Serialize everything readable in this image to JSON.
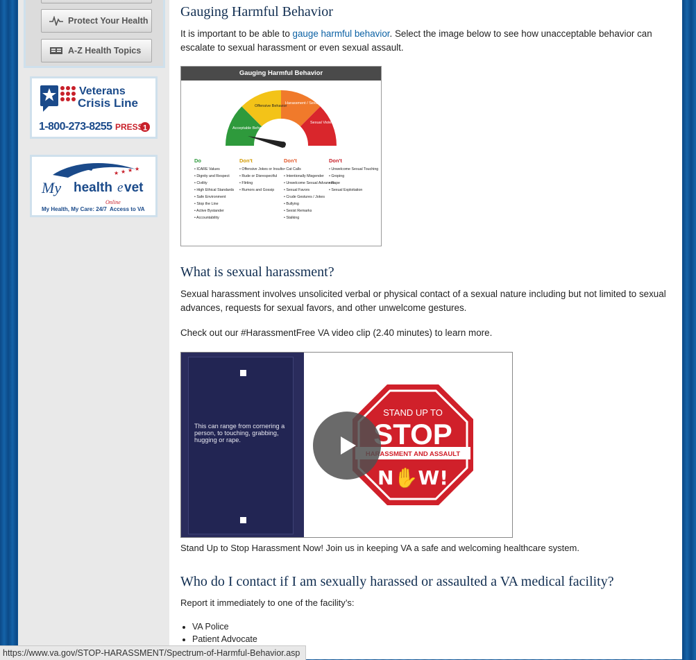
{
  "sidebar": {
    "nav": [
      {
        "label": "Protect Your Health",
        "icon": "heartbeat-icon"
      },
      {
        "label": "A-Z Health Topics",
        "icon": "book-icon"
      }
    ],
    "crisis": {
      "line1": "Veterans",
      "line2": "Crisis Line",
      "phone": "1-800-273-8255",
      "press": "PRESS",
      "key": "1"
    },
    "mhv": {
      "my": "My",
      "health": "health",
      "e": "e",
      "vet": "vet",
      "online": "Online",
      "tagline_a": "My Health, My Care: 24/7",
      "tagline_b": "Access to VA"
    }
  },
  "main": {
    "section1": {
      "title": "Gauging Harmful Behavior",
      "text_before": "It is important to be able to ",
      "link": "gauge harmful behavior",
      "text_after": ". Select the image below to see how unacceptable behavior can escalate to sexual harassment or even sexual assault."
    },
    "gauge": {
      "title": "Gauging Harmful Behavior",
      "segments": [
        "Acceptable Behavior",
        "Offensive Behavior",
        "Harassment / Sexual Harassment",
        "Sexual Violence Assault"
      ],
      "columns": [
        {
          "head": "Do",
          "color": "#2e9a3c",
          "items": [
            "ICARE Values",
            "Dignity and Respect",
            "Civility",
            "High Ethical Standards",
            "Safe Environment",
            "Stop the Line",
            "Active Bystander",
            "Accountability"
          ]
        },
        {
          "head": "Don't",
          "color": "#d29a00",
          "items": [
            "Offensive Jokes or Insults",
            "Rude or Disrespectful",
            "Flirting",
            "Rumors and Gossip"
          ]
        },
        {
          "head": "Don't",
          "color": "#e2582a",
          "items": [
            "Cat Calls",
            "Intentionally Misgender",
            "Unwelcome Sexual Advances",
            "Sexual Favors",
            "Crude Gestures / Jokes",
            "Bullying",
            "Sexist Remarks",
            "Stalking"
          ]
        },
        {
          "head": "Don't",
          "color": "#c8202a",
          "items": [
            "Unwelcome Sexual Touching",
            "Groping",
            "Rape",
            "Sexual Exploitation"
          ]
        }
      ]
    },
    "section2": {
      "title": "What is sexual harassment?",
      "p1": "Sexual harassment involves unsolicited verbal or physical contact of a sexual nature including but not limited to sexual advances, requests for sexual favors, and other unwelcome gestures.",
      "p2": "Check out our #HarassmentFree VA video clip (2.40 minutes) to learn more."
    },
    "video": {
      "caption_on_video": "This can range from cornering a person, to touching, grabbing, hugging or rape.",
      "sign_top": "STAND UP TO",
      "sign_stop": "STOP",
      "sign_band": "HARASSMENT AND ASSAULT",
      "sign_now": "N✋W!",
      "caption": "Stand Up to Stop Harassment Now! Join us in keeping VA a safe and welcoming healthcare system."
    },
    "section3": {
      "title": "Who do I contact if I am sexually harassed or assaulted a VA medical facility?",
      "intro": "Report it immediately to one of the facility’s:",
      "list": [
        "VA Police",
        "Patient Advocate"
      ]
    }
  },
  "status_url": "https://www.va.gov/STOP-HARASSMENT/Spectrum-of-Harmful-Behavior.asp"
}
